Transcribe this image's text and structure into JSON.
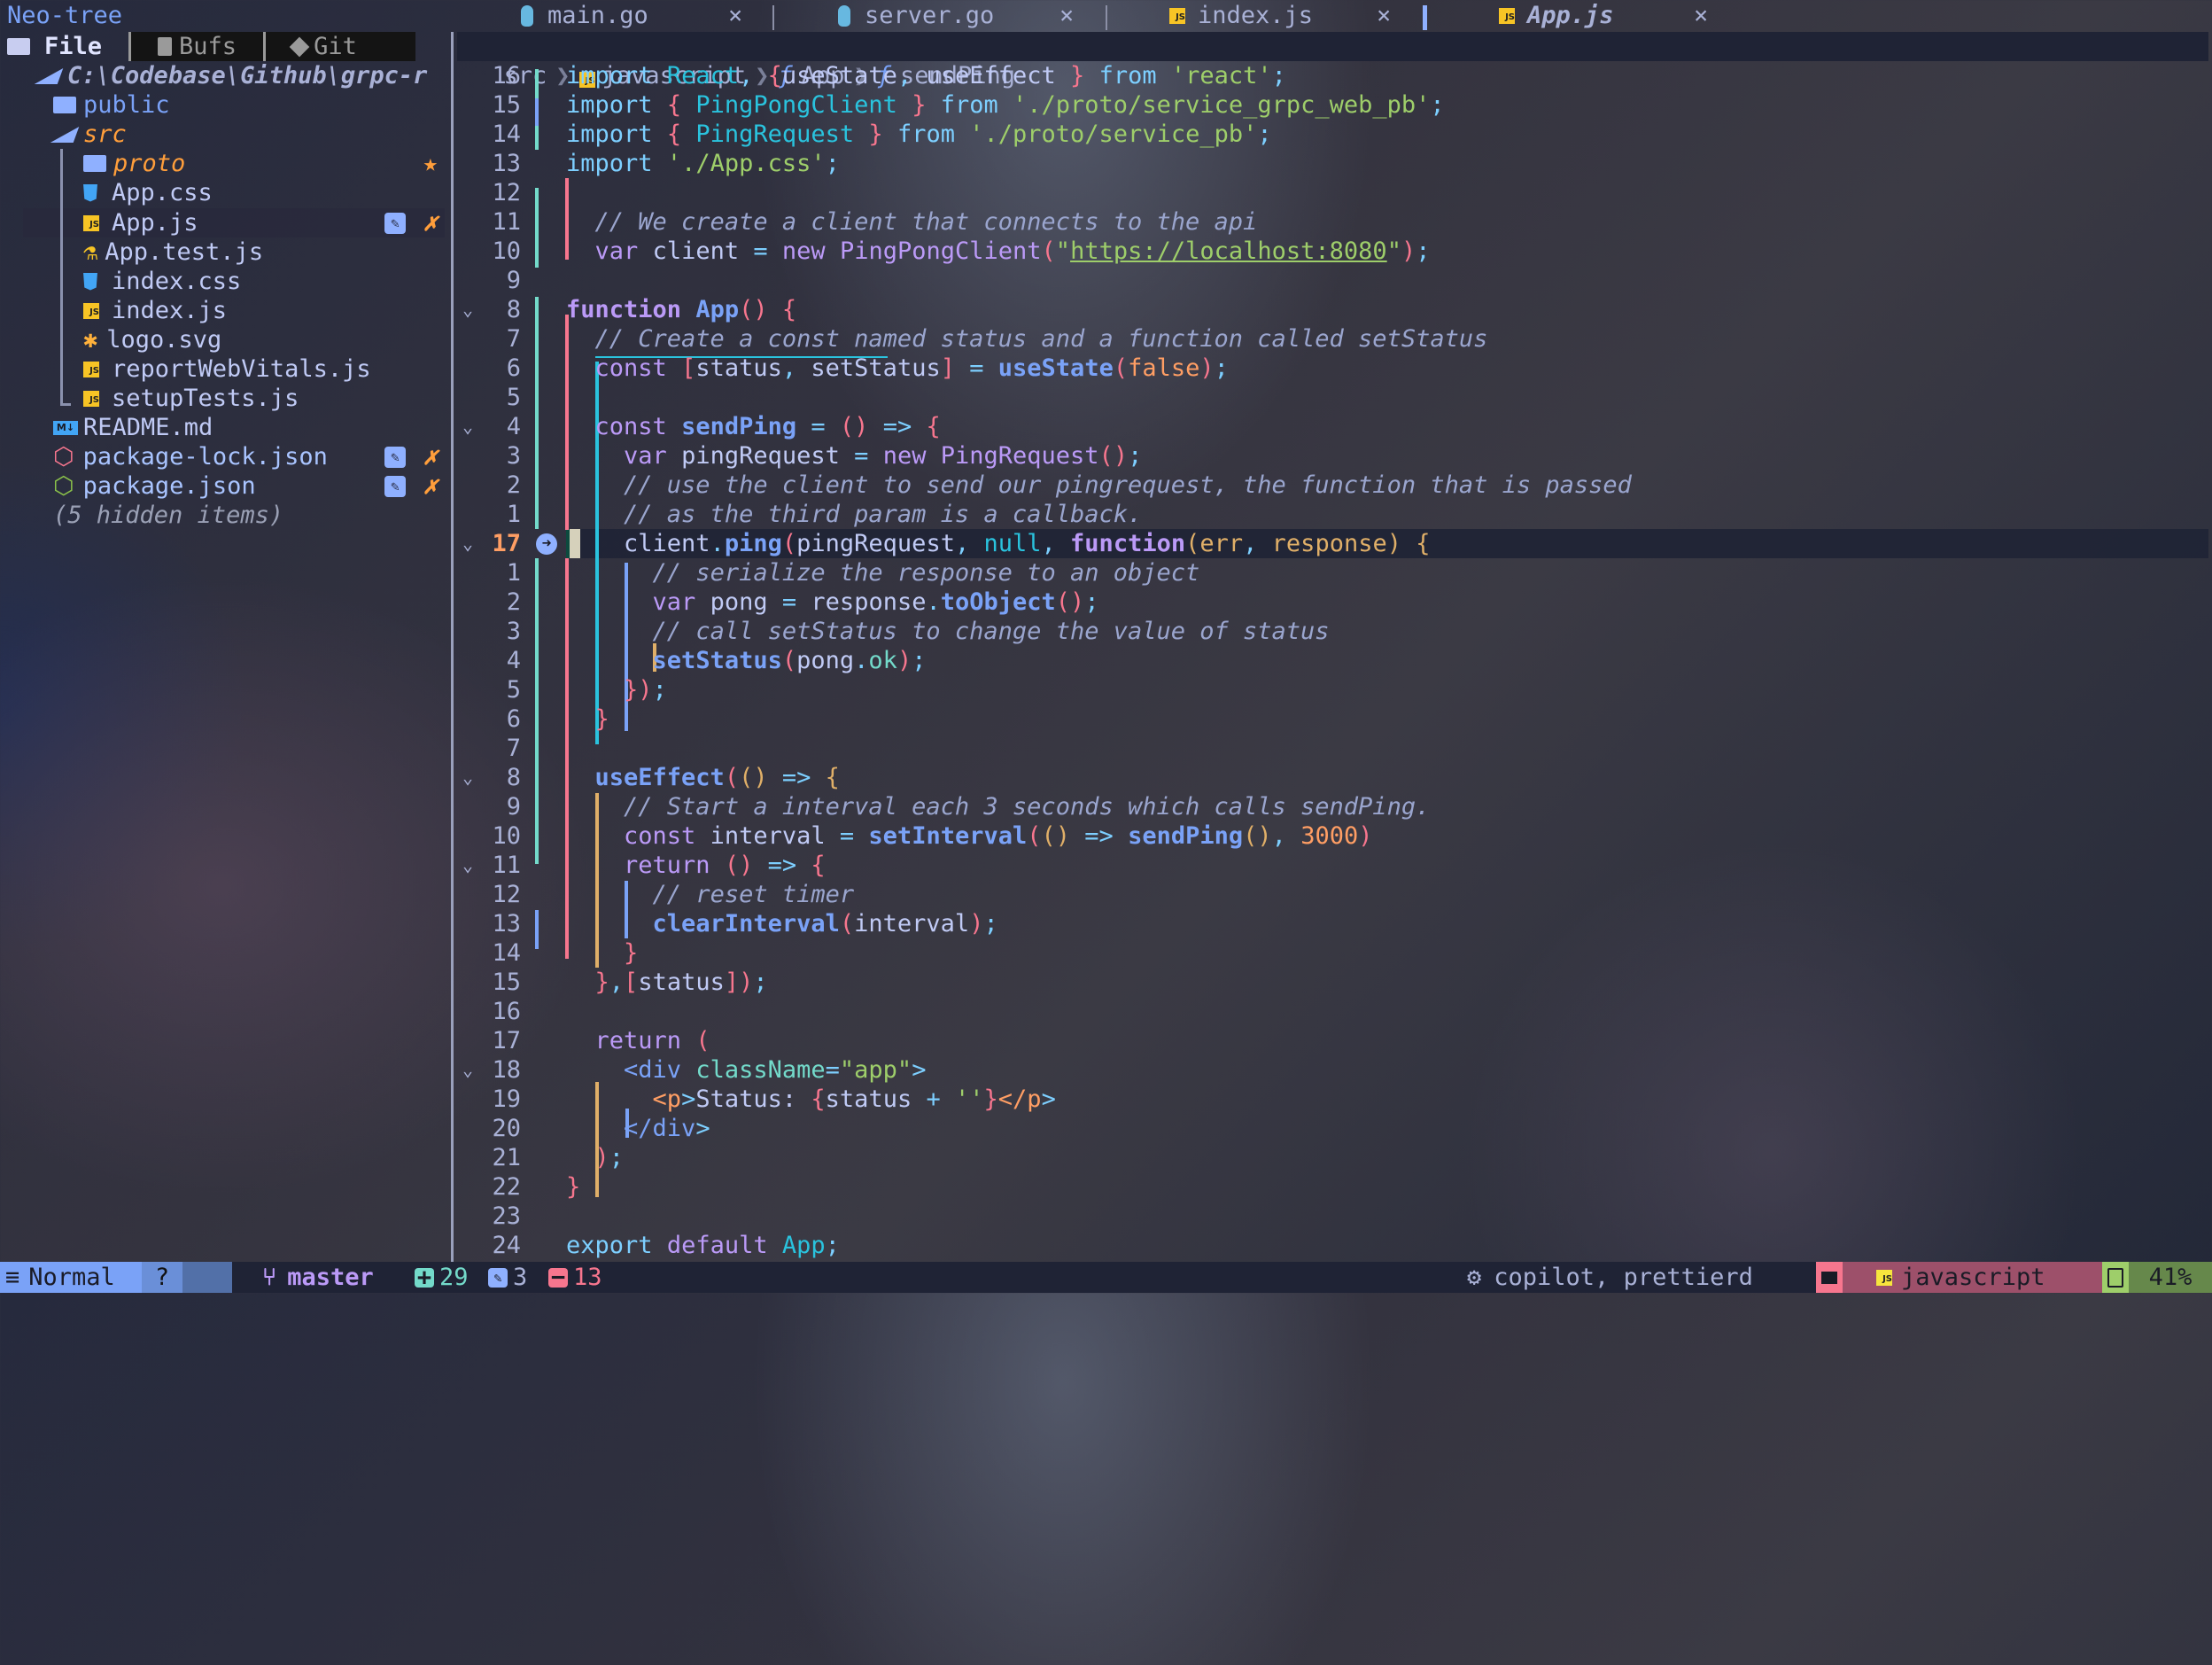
{
  "sidebar": {
    "title": "Neo-tree",
    "source_tabs": [
      {
        "label": "File",
        "active": true
      },
      {
        "label": "Bufs",
        "active": false
      },
      {
        "label": "Git",
        "active": false
      }
    ],
    "root": "C:\\Codebase\\Github\\grpc-r",
    "tree": [
      {
        "name": "public",
        "type": "folder",
        "depth": 1
      },
      {
        "name": "src",
        "type": "folder-open",
        "depth": 1
      },
      {
        "name": "proto",
        "type": "folder",
        "depth": 2,
        "status": "★"
      },
      {
        "name": "App.css",
        "type": "css",
        "depth": 2
      },
      {
        "name": "App.js",
        "type": "js",
        "depth": 2,
        "status": "✗",
        "selected": true
      },
      {
        "name": "App.test.js",
        "type": "test",
        "depth": 2
      },
      {
        "name": "index.css",
        "type": "css",
        "depth": 2
      },
      {
        "name": "index.js",
        "type": "js",
        "depth": 2
      },
      {
        "name": "logo.svg",
        "type": "svg",
        "depth": 2
      },
      {
        "name": "reportWebVitals.js",
        "type": "js",
        "depth": 2
      },
      {
        "name": "setupTests.js",
        "type": "js",
        "depth": 2
      },
      {
        "name": "README.md",
        "type": "md",
        "depth": 1
      },
      {
        "name": "package-lock.json",
        "type": "npm-lock",
        "depth": 1,
        "status": "✗"
      },
      {
        "name": "package.json",
        "type": "npm",
        "depth": 1,
        "status": "✗"
      }
    ],
    "hidden_note": "(5 hidden items)"
  },
  "tabs": [
    {
      "label": "main.go",
      "icon": "go-gopher-icon",
      "close": "×"
    },
    {
      "label": "server.go",
      "icon": "go-gopher-icon",
      "close": "×"
    },
    {
      "label": "index.js",
      "icon": "js-icon",
      "close": "×"
    },
    {
      "label": "App.js",
      "icon": "js-icon",
      "close": "×",
      "active": true
    }
  ],
  "winbar": {
    "crumbs": [
      "src",
      "javascript",
      "App",
      "sendPing"
    ],
    "fn_glyph": "ƒ"
  },
  "editor": {
    "current_line": 17,
    "line_numbers": [
      "16",
      "15",
      "14",
      "13",
      "12",
      "11",
      "10",
      "9",
      "8",
      "7",
      "6",
      "5",
      "4",
      "3",
      "2",
      "1",
      "17",
      "1",
      "2",
      "3",
      "4",
      "5",
      "6",
      "7",
      "8",
      "9",
      "10",
      "11",
      "12",
      "13",
      "14",
      "15",
      "16",
      "17",
      "18",
      "19",
      "20",
      "21",
      "22",
      "23",
      "24"
    ],
    "folds": [
      8,
      12,
      16,
      24,
      27,
      34
    ],
    "lines": [
      "import React, {useState, useEffect } from 'react';",
      "import { PingPongClient } from './proto/service_grpc_web_pb';",
      "import { PingRequest } from './proto/service_pb';",
      "import './App.css';",
      "",
      "  // We create a client that connects to the api",
      "  var client = new PingPongClient(\"https://localhost:8080\");",
      "",
      "function App() {",
      "  // Create a const named status and a function called setStatus",
      "  const [status, setStatus] = useState(false);",
      "",
      "  const sendPing = () => {",
      "    var pingRequest = new PingRequest();",
      "    // use the client to send our pingrequest, the function that is passed",
      "    // as the third param is a callback.",
      "    client.ping(pingRequest, null, function(err, response) {",
      "      // serialize the response to an object",
      "      var pong = response.toObject();",
      "      // call setStatus to change the value of status",
      "      setStatus(pong.ok);",
      "    });",
      "  }",
      "",
      "  useEffect(() => {",
      "    // Start a interval each 3 seconds which calls sendPing.",
      "    const interval = setInterval(() => sendPing(), 3000)",
      "    return () => {",
      "      // reset timer",
      "      clearInterval(interval);",
      "    }",
      "  },[status]);",
      "",
      "  return (",
      "    <div className=\"app\">",
      "      <p>Status: {status + ''}</p>",
      "    </div>",
      "  );",
      "}",
      "",
      "export default App;"
    ]
  },
  "statusline": {
    "mode": "Normal",
    "mode_extra": "?",
    "branch": "master",
    "added": "29",
    "changed": "3",
    "removed": "13",
    "lsp": "copilot, prettierd",
    "filetype": "javascript",
    "progress": "41%"
  },
  "colors": {
    "mode_bg": "#7aa2f7",
    "added": "#73daca",
    "changed": "#7aa2f7",
    "removed": "#f7768e",
    "filetype_bg": "#9d506a",
    "progress_bg": "#66884b"
  }
}
